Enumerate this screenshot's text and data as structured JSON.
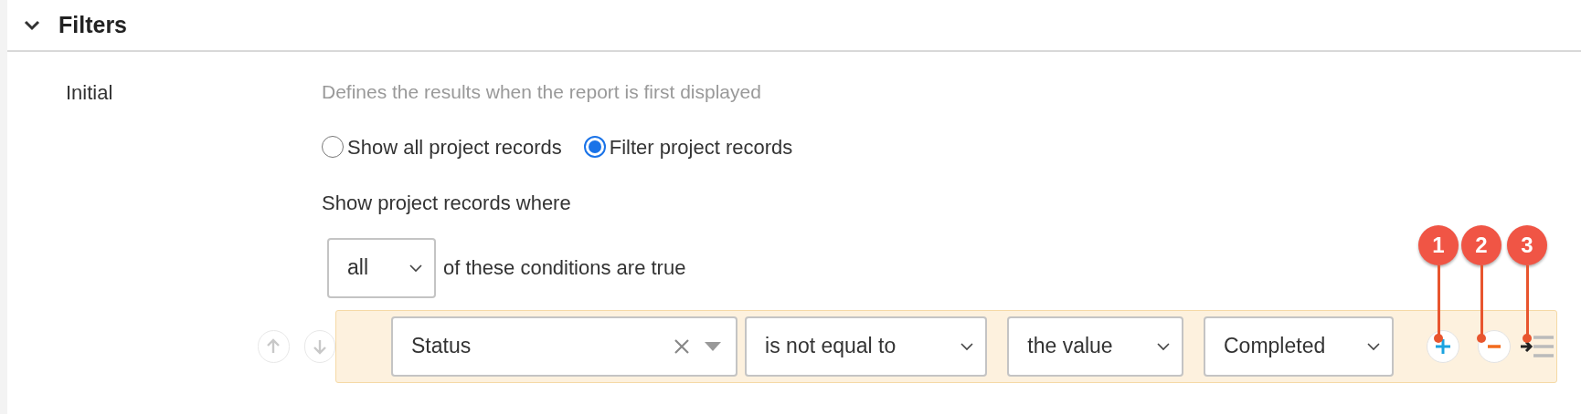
{
  "section": {
    "title": "Filters",
    "expanded": true
  },
  "initial": {
    "label": "Initial",
    "description": "Defines the results when the report is first displayed",
    "radios": [
      {
        "label": "Show all project records",
        "selected": false
      },
      {
        "label": "Filter project records",
        "selected": true
      }
    ],
    "condition_heading": "Show project records where",
    "match": {
      "value": "all",
      "suffix": "of these conditions are true"
    },
    "conditions": [
      {
        "field": "Status",
        "operator": "is not equal to",
        "value_type": "the value",
        "value": "Completed"
      }
    ],
    "callouts": [
      "1",
      "2",
      "3"
    ]
  }
}
